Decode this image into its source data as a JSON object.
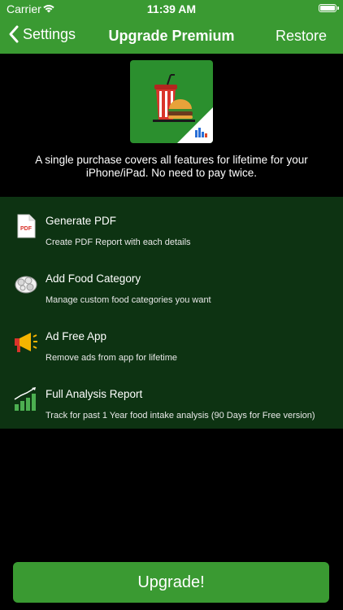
{
  "status": {
    "carrier": "Carrier",
    "time": "11:39 AM"
  },
  "nav": {
    "back_label": "Settings",
    "title": "Upgrade Premium",
    "restore_label": "Restore"
  },
  "description": "A single purchase covers all features for lifetime for your iPhone/iPad. No need to pay twice.",
  "features": [
    {
      "title": "Generate PDF",
      "subtitle": "Create PDF Report with each details",
      "icon": "pdf-icon"
    },
    {
      "title": "Add Food Category",
      "subtitle": "Manage custom food categories you want",
      "icon": "food-category-icon"
    },
    {
      "title": "Ad Free App",
      "subtitle": "Remove ads from app for lifetime",
      "icon": "megaphone-icon"
    },
    {
      "title": "Full Analysis Report",
      "subtitle": "Track for past 1 Year food intake analysis (90 Days for Free version)",
      "icon": "analysis-chart-icon"
    }
  ],
  "upgrade_label": "Upgrade!",
  "colors": {
    "accent": "#3a9a32",
    "feature_bg": "#0d3312",
    "background": "#000000"
  }
}
